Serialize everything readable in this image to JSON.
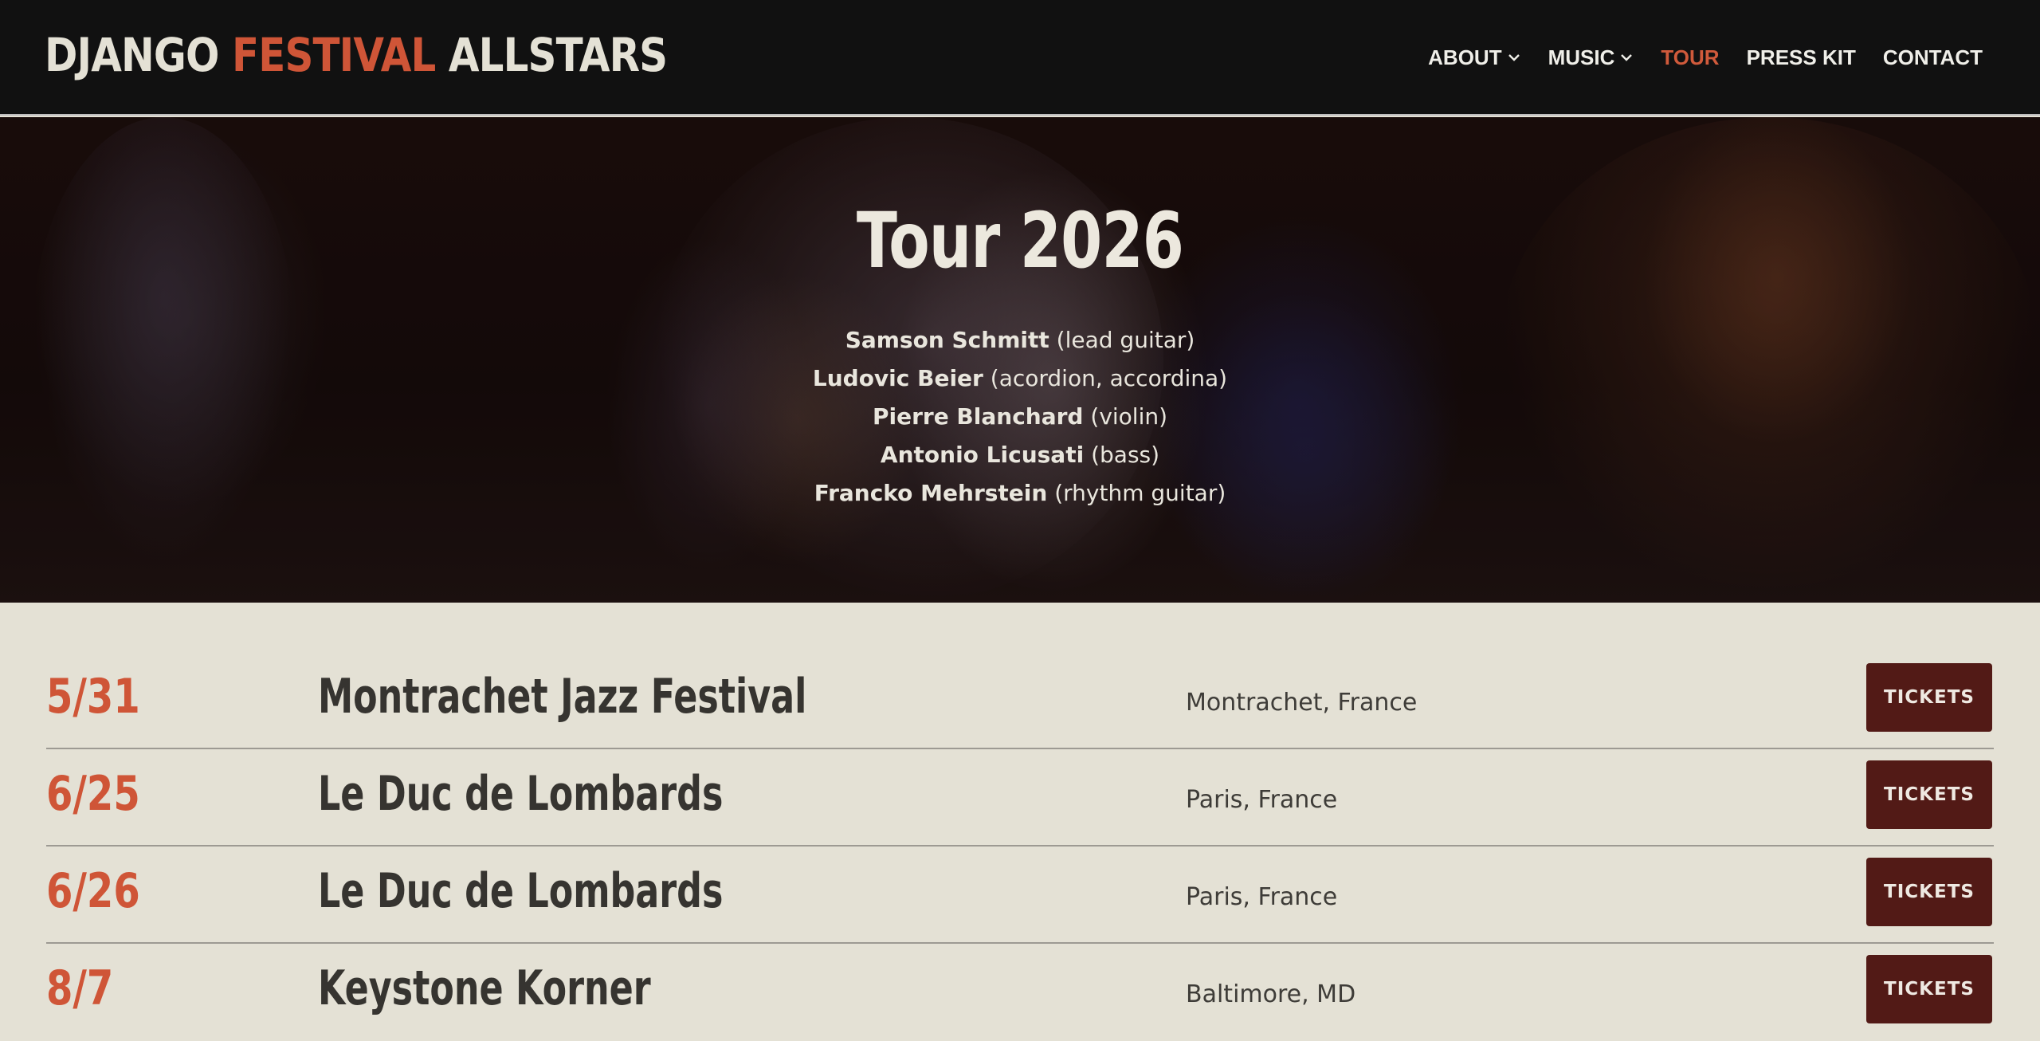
{
  "header": {
    "logo": {
      "word1": "DJANGO",
      "word2": "FESTIVAL",
      "word3": "ALLSTARS"
    },
    "nav": [
      {
        "label": "ABOUT",
        "dropdown": true,
        "active": false
      },
      {
        "label": "MUSIC",
        "dropdown": true,
        "active": false
      },
      {
        "label": "TOUR",
        "dropdown": false,
        "active": true
      },
      {
        "label": "PRESS KIT",
        "dropdown": false,
        "active": false
      },
      {
        "label": "CONTACT",
        "dropdown": false,
        "active": false
      }
    ]
  },
  "hero": {
    "title": "Tour 2026",
    "members": [
      {
        "name": "Samson Schmitt",
        "role": "(lead guitar)"
      },
      {
        "name": "Ludovic Beier",
        "role": "(acordion, accordina)"
      },
      {
        "name": "Pierre Blanchard",
        "role": "(violin)"
      },
      {
        "name": "Antonio Licusati",
        "role": "(bass)"
      },
      {
        "name": "Francko Mehrstein",
        "role": "(rhythm guitar)"
      }
    ]
  },
  "tour": {
    "button_label": "TICKETS",
    "dates": [
      {
        "date": "5/31",
        "venue": "Montrachet Jazz Festival",
        "location": "Montrachet, France"
      },
      {
        "date": "6/25",
        "venue": "Le Duc de Lombards",
        "location": "Paris, France"
      },
      {
        "date": "6/26",
        "venue": "Le Duc de Lombards",
        "location": "Paris, France"
      },
      {
        "date": "8/7",
        "venue": "Keystone Korner",
        "location": "Baltimore, MD"
      }
    ]
  },
  "colors": {
    "accent": "#cf5537",
    "header_bg": "#111111",
    "page_bg": "#e4e1d5",
    "button_bg": "#521a16",
    "text_dark": "#363430"
  },
  "icons": {
    "dropdown": "chevron-down-icon"
  }
}
